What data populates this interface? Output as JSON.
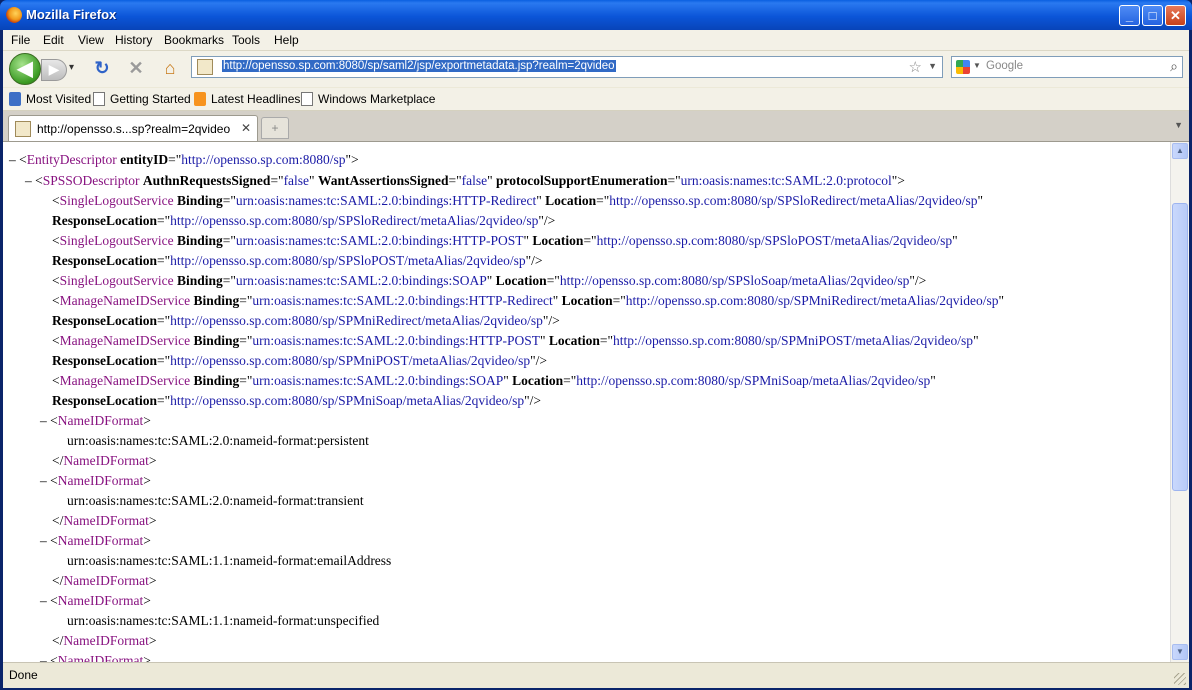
{
  "window": {
    "title": "Mozilla Firefox",
    "minimize": "_",
    "maximize": "□",
    "close": "✕"
  },
  "menu": [
    "File",
    "Edit",
    "View",
    "History",
    "Bookmarks",
    "Tools",
    "Help"
  ],
  "nav": {
    "back_icon": "◀",
    "forward_icon": "▶",
    "reload_icon": "↻",
    "stop_icon": "✕",
    "home_icon": "⌂",
    "url": "http://opensso.sp.com:8080/sp/saml2/jsp/exportmetadata.jsp?realm=2qvideo",
    "search_placeholder": "Google"
  },
  "bookmarks": [
    "Most Visited",
    "Getting Started",
    "Latest Headlines",
    "Windows Marketplace"
  ],
  "tab": {
    "label": "http://opensso.s...sp?realm=2qvideo",
    "new_tab": "+"
  },
  "status": "Done",
  "xml": {
    "entity": {
      "tag": "EntityDescriptor",
      "attr": "entityID",
      "val": "http://opensso.sp.com:8080/sp"
    },
    "spsso": {
      "tag": "SPSSODescriptor",
      "a1": "AuthnRequestsSigned",
      "v1": "false",
      "a2": "WantAssertionsSigned",
      "v2": "false",
      "a3": "protocolSupportEnumeration",
      "v3": "urn:oasis:names:tc:SAML:2.0:protocol"
    },
    "slo": [
      {
        "tag": "SingleLogoutService",
        "binding": "urn:oasis:names:tc:SAML:2.0:bindings:HTTP-Redirect",
        "location": "http://opensso.sp.com:8080/sp/SPSloRedirect/metaAlias/2qvideo/sp",
        "response": "http://opensso.sp.com:8080/sp/SPSloRedirect/metaAlias/2qvideo/sp"
      },
      {
        "tag": "SingleLogoutService",
        "binding": "urn:oasis:names:tc:SAML:2.0:bindings:HTTP-POST",
        "location": "http://opensso.sp.com:8080/sp/SPSloPOST/metaAlias/2qvideo/sp",
        "response": "http://opensso.sp.com:8080/sp/SPSloPOST/metaAlias/2qvideo/sp"
      },
      {
        "tag": "SingleLogoutService",
        "binding": "urn:oasis:names:tc:SAML:2.0:bindings:SOAP",
        "location": "http://opensso.sp.com:8080/sp/SPSloSoap/metaAlias/2qvideo/sp"
      }
    ],
    "mni": [
      {
        "tag": "ManageNameIDService",
        "binding": "urn:oasis:names:tc:SAML:2.0:bindings:HTTP-Redirect",
        "location": "http://opensso.sp.com:8080/sp/SPMniRedirect/metaAlias/2qvideo/sp",
        "response": "http://opensso.sp.com:8080/sp/SPMniRedirect/metaAlias/2qvideo/sp"
      },
      {
        "tag": "ManageNameIDService",
        "binding": "urn:oasis:names:tc:SAML:2.0:bindings:HTTP-POST",
        "location": "http://opensso.sp.com:8080/sp/SPMniPOST/metaAlias/2qvideo/sp",
        "response": "http://opensso.sp.com:8080/sp/SPMniPOST/metaAlias/2qvideo/sp"
      },
      {
        "tag": "ManageNameIDService",
        "binding": "urn:oasis:names:tc:SAML:2.0:bindings:SOAP",
        "location": "http://opensso.sp.com:8080/sp/SPMniSoap/metaAlias/2qvideo/sp",
        "response": "http://opensso.sp.com:8080/sp/SPMniSoap/metaAlias/2qvideo/sp"
      }
    ],
    "attr_names": {
      "binding": "Binding",
      "location": "Location",
      "response": "ResponseLocation"
    },
    "nameid_tag": "NameIDFormat",
    "nameid_formats": [
      "urn:oasis:names:tc:SAML:2.0:nameid-format:persistent",
      "urn:oasis:names:tc:SAML:2.0:nameid-format:transient",
      "urn:oasis:names:tc:SAML:1.1:nameid-format:emailAddress",
      "urn:oasis:names:tc:SAML:1.1:nameid-format:unspecified"
    ]
  }
}
